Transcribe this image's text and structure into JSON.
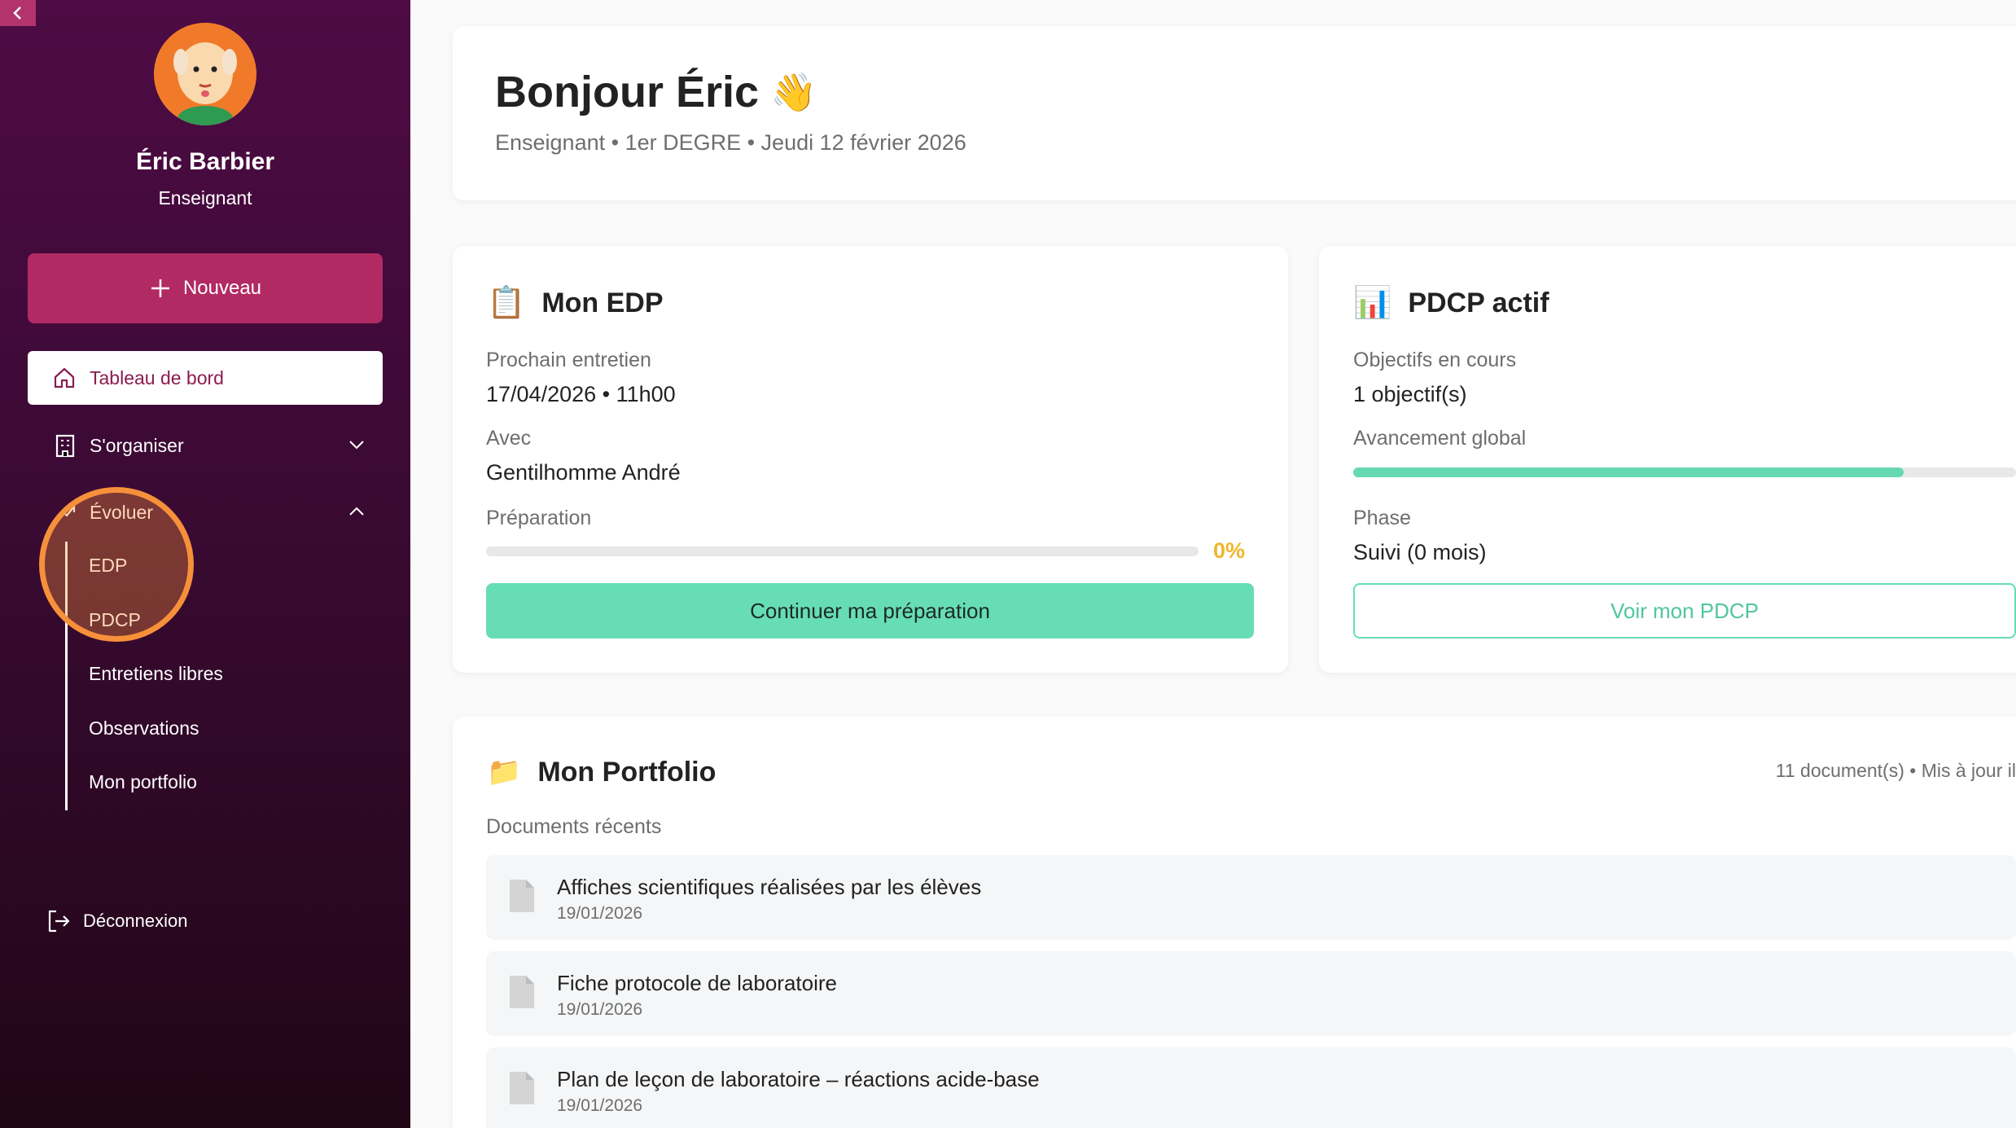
{
  "sidebar": {
    "user_name": "Éric Barbier",
    "user_role": "Enseignant",
    "new_button": "Nouveau",
    "nav": {
      "dashboard": "Tableau de bord",
      "organize": "S'organiser",
      "evolve": "Évoluer"
    },
    "sub_items": [
      "EDP",
      "PDCP",
      "Entretiens libres",
      "Observations",
      "Mon portfolio"
    ],
    "logout": "Déconnexion"
  },
  "header": {
    "greeting": "Bonjour Éric",
    "emoji": "👋",
    "subtitle": "Enseignant • 1er DEGRE • Jeudi 12 février 2026"
  },
  "edp": {
    "icon": "📋",
    "title": "Mon EDP",
    "next_label": "Prochain entretien",
    "next_value": "17/04/2026 • 11h00",
    "with_label": "Avec",
    "with_value": "Gentilhomme André",
    "prep_label": "Préparation",
    "prep_percent": "0%",
    "prep_fraction": 0,
    "button": "Continuer ma préparation"
  },
  "pdcp": {
    "icon": "📊",
    "title": "PDCP actif",
    "objectives_label": "Objectifs en cours",
    "objectives_value": "1 objectif(s)",
    "progress_label": "Avancement global",
    "progress_fraction": 0.83,
    "phase_label": "Phase",
    "phase_value": "Suivi (0 mois)",
    "button": "Voir mon PDCP"
  },
  "portfolio": {
    "icon": "📁",
    "title": "Mon Portfolio",
    "meta": "11 document(s) • Mis à jour il",
    "recent_label": "Documents récents",
    "documents": [
      {
        "name": "Affiches scientifiques réalisées par les élèves",
        "date": "19/01/2026"
      },
      {
        "name": "Fiche protocole de laboratoire",
        "date": "19/01/2026"
      },
      {
        "name": "Plan de leçon de laboratoire – réactions acide-base",
        "date": "19/01/2026"
      }
    ]
  },
  "colors": {
    "sidebar_top": "#4e0b45",
    "accent": "#b22a64",
    "mint": "#66d9b4",
    "highlight": "#f6903a"
  }
}
